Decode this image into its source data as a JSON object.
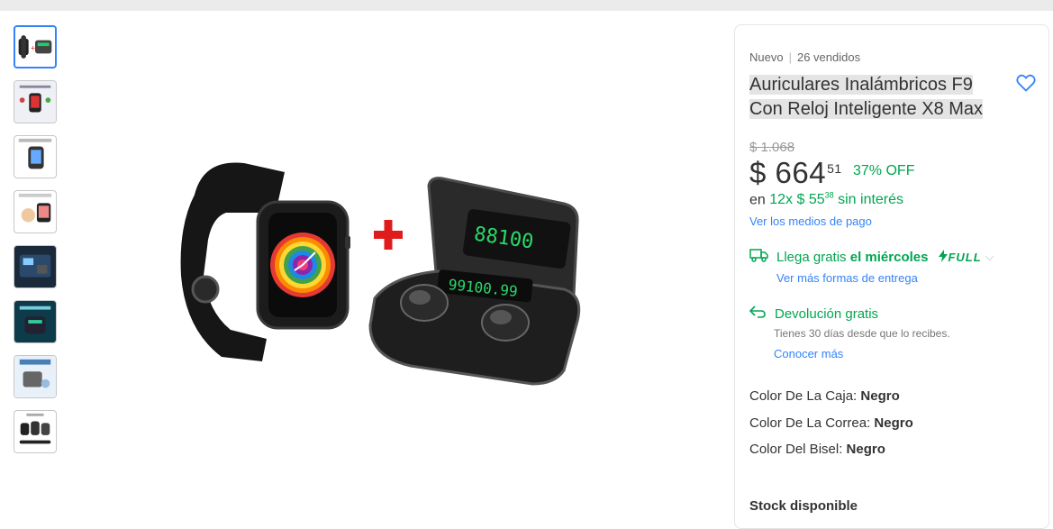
{
  "gallery": {
    "thumbnails": [
      {
        "name": "thumb-watch-earbuds-combo"
      },
      {
        "name": "thumb-watch-features"
      },
      {
        "name": "thumb-watch-side"
      },
      {
        "name": "thumb-watch-lifestyle"
      },
      {
        "name": "thumb-earbuds-case"
      },
      {
        "name": "thumb-earbuds-waterproof"
      },
      {
        "name": "thumb-earbuds-charging"
      },
      {
        "name": "thumb-watch-colors"
      }
    ],
    "selected_index": 0
  },
  "product": {
    "condition": "Nuevo",
    "sold": "26 vendidos",
    "title": "Auriculares Inalámbricos F9 Con Reloj Inteligente X8 Max",
    "old_price": "$ 1.068",
    "price_currency": "$",
    "price_whole": "664",
    "price_cents": "51",
    "discount": "37% OFF",
    "installments_prefix": "en",
    "installments_count": "12x $ 55",
    "installments_cents": "38",
    "installments_suffix": "sin interés",
    "payment_link": "Ver los medios de pago"
  },
  "shipping": {
    "label": "Llega gratis",
    "day": "el miércoles",
    "badge": "FULL",
    "more_link": "Ver más formas de entrega"
  },
  "returns": {
    "label": "Devolución gratis",
    "note": "Tienes 30 días desde que lo recibes.",
    "link": "Conocer más"
  },
  "attributes": [
    {
      "label": "Color De La Caja:",
      "value": "Negro"
    },
    {
      "label": "Color De La Correa:",
      "value": "Negro"
    },
    {
      "label": "Color Del Bisel:",
      "value": "Negro"
    }
  ],
  "stock": "Stock disponible",
  "colors": {
    "accent": "#3483fa",
    "green": "#00a650"
  }
}
